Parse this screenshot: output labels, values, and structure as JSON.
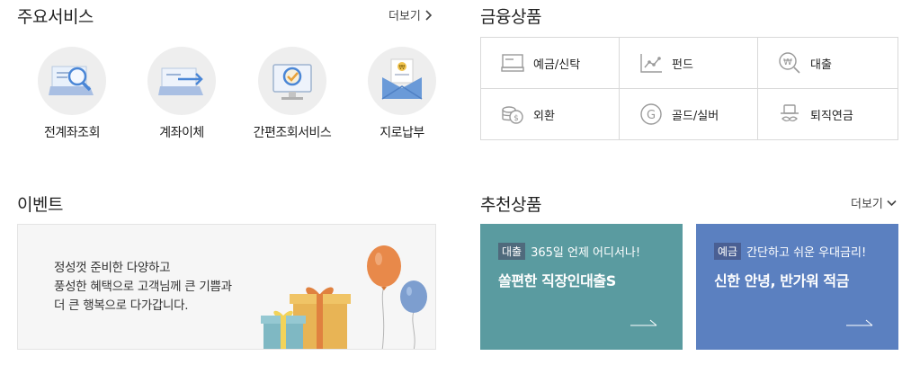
{
  "main_services": {
    "title": "주요서비스",
    "more_label": "더보기",
    "items": [
      {
        "label": "전계좌조회",
        "icon": "account-search-icon"
      },
      {
        "label": "계좌이체",
        "icon": "transfer-icon"
      },
      {
        "label": "간편조회서비스",
        "icon": "quick-check-icon"
      },
      {
        "label": "지로납부",
        "icon": "giro-payment-icon"
      }
    ]
  },
  "financial_products": {
    "title": "금융상품",
    "items": [
      {
        "label": "예금/신탁",
        "icon": "deposit-icon"
      },
      {
        "label": "펀드",
        "icon": "fund-chart-icon"
      },
      {
        "label": "대출",
        "icon": "loan-won-icon"
      },
      {
        "label": "외환",
        "icon": "coins-icon"
      },
      {
        "label": "골드/실버",
        "icon": "gold-g-icon"
      },
      {
        "label": "퇴직연금",
        "icon": "pension-hat-icon"
      }
    ]
  },
  "event": {
    "title": "이벤트",
    "lines": [
      "정성껏 준비한 다양하고",
      "풍성한 혜택으로 고객님께 큰 기쁨과",
      "더 큰 행복으로 다가갑니다."
    ]
  },
  "recommended": {
    "title": "추천상품",
    "more_label": "더보기",
    "cards": [
      {
        "badge": "대출",
        "subtitle": "365일 언제 어디서나!",
        "headline": "쏠편한 직장인대출S",
        "bg": "#5a9ba0",
        "badge_bg": "#4f6a7c"
      },
      {
        "badge": "예금",
        "subtitle": "간단하고 쉬운 우대금리!",
        "headline": "신한 안녕, 반가워 적금",
        "bg": "#5b80c0",
        "badge_bg": "#4a5f93"
      }
    ]
  },
  "colors": {
    "icon_gray": "#9a9a9a",
    "balloon_orange": "#e8894a",
    "balloon_blue": "#7d9ecf",
    "gift_yellow": "#e8b455",
    "gift_teal": "#7fb8c3"
  }
}
